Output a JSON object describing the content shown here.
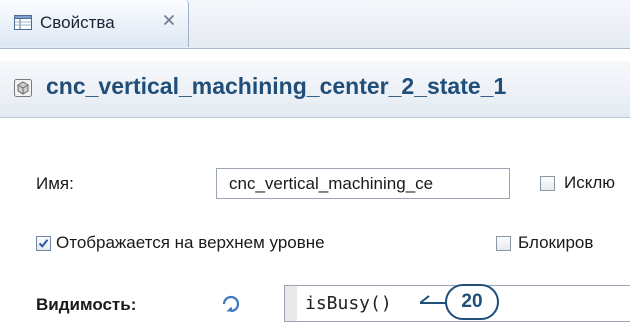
{
  "tab": {
    "label": "Свойства",
    "icon": "properties-view-icon",
    "close_icon": "close-icon"
  },
  "header": {
    "title": "cnc_vertical_machining_center_2_state_1",
    "icon": "state-icon"
  },
  "form": {
    "name_label": "Имя:",
    "name_value": "cnc_vertical_machining_ce",
    "exclude_label": "Исклю",
    "exclude_checked": false,
    "show_top_label": "Отображается на верхнем уровне",
    "show_top_checked": true,
    "lock_label": "Блокиров",
    "lock_checked": false,
    "visibility_label": "Видимость:",
    "visibility_icon": "dynamic-value-icon",
    "visibility_expression": "isBusy()",
    "callout_number": "20"
  },
  "colors": {
    "title": "#1f4e79",
    "callout": "#1f4e79"
  }
}
